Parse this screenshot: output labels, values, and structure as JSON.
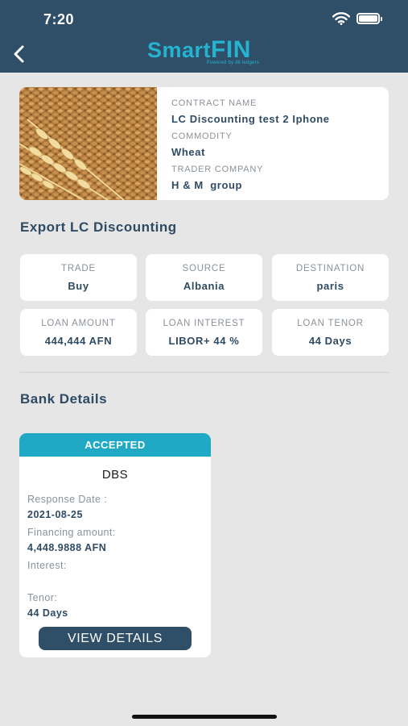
{
  "status_bar": {
    "time": "7:20"
  },
  "header": {
    "logo_title": "SmartFIN",
    "logo_subtitle": "Powered by dlt ledgers"
  },
  "contract": {
    "contract_name_label": "CONTRACT NAME",
    "contract_name": "LC Discounting test 2 Iphone",
    "commodity_label": "COMMODITY",
    "commodity": "Wheat",
    "trader_company_label": "TRADER COMPANY",
    "trader_company": "H & M  group"
  },
  "section_export": {
    "title": "Export LC Discounting"
  },
  "details": [
    {
      "label": "TRADE",
      "value": "Buy"
    },
    {
      "label": "SOURCE",
      "value": "Albania"
    },
    {
      "label": "DESTINATION",
      "value": "paris"
    },
    {
      "label": "LOAN AMOUNT",
      "value": "444,444 AFN"
    },
    {
      "label": "LOAN INTEREST",
      "value": "LIBOR+ 44 %"
    },
    {
      "label": "LOAN TENOR",
      "value": "44 Days"
    }
  ],
  "section_bank": {
    "title": "Bank Details"
  },
  "bank_card": {
    "status": "ACCEPTED",
    "status_color": "#1fa9c4",
    "bank_name": "DBS",
    "response_date_label": "Response Date :",
    "response_date": "2021-08-25",
    "financing_amount_label": "Financing amount:",
    "financing_amount": "4,448.9888 AFN",
    "interest_label": "Interest:",
    "interest": "",
    "tenor_label": "Tenor:",
    "tenor": "44 Days",
    "view_details_label": "VIEW DETAILS"
  },
  "colors": {
    "header_bg": "#2f4e68",
    "accent": "#25b3d0",
    "page_bg": "#e6e6e6"
  }
}
